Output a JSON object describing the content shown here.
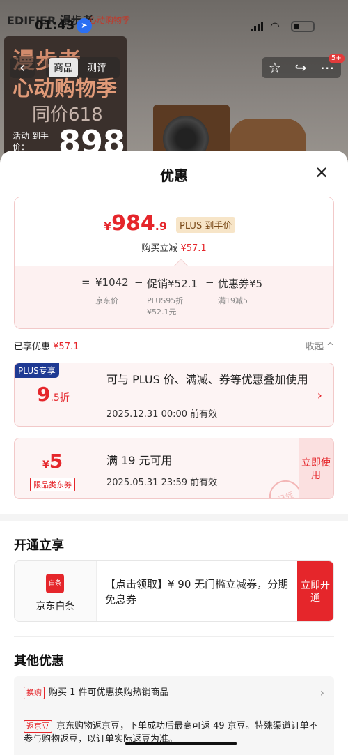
{
  "status": {
    "time": "01:43"
  },
  "background": {
    "brand": "EDIFIER 漫步者",
    "brand_sub": "心动购物季",
    "promo_line1": "漫步者",
    "promo_line2": "心动购物季",
    "promo_line3": "同价618",
    "promo_label": "活动 到手价：",
    "promo_price": "898"
  },
  "nav": {
    "back_icon": "chevron-left-icon",
    "tabs": [
      "商品",
      "测评"
    ],
    "active_tab": 0,
    "badge": "5+"
  },
  "sheet": {
    "title": "优惠",
    "summary": {
      "price_symbol": "¥",
      "price_int": "984",
      "price_dec": ".9",
      "plus_tag": "PLUS 到手价",
      "subtitle": "购买立减",
      "subtitle_amount": "¥57.1",
      "eq": "=",
      "base_price": "¥1042",
      "minus1": "−",
      "promo": "促销¥52.1",
      "minus2": "−",
      "coupon": "优惠券¥5",
      "base_label": "京东价",
      "promo_label1": "PLUS95折",
      "promo_label2": "¥52.1元",
      "coupon_label": "满19减5"
    },
    "enjoyed": {
      "label": "已享优惠",
      "amount": "¥57.1",
      "collapse": "收起 ^"
    },
    "coupons": [
      {
        "header": "PLUS专享",
        "value_big": "9",
        "value_small": ".5折",
        "desc": "可与 PLUS 价、满减、券等优惠叠加使用",
        "date": "2025.12.31 00:00 前有效"
      },
      {
        "symbol": "¥",
        "value_big": "5",
        "tag": "限品类东券",
        "desc": "满 19 元可用",
        "date": "2025.05.31 23:59 前有效",
        "action": "立即使用",
        "stamp": "已领"
      }
    ],
    "open_section": {
      "title": "开通立享",
      "icon_text": "白条",
      "name": "京东白条",
      "text": "【点击领取】¥ 90 无门槛立减券，分期免息券",
      "action": "立即开通"
    },
    "other_section": {
      "title": "其他优惠",
      "items": [
        {
          "tag": "换购",
          "text": "购买 1 件可优惠换购热销商品"
        },
        {
          "tag": "返京豆",
          "text": "京东购物返京豆，下单成功后最高可返 49 京豆。特殊渠道订单不参与购物返豆，以订单实际返豆为准。"
        }
      ]
    }
  },
  "colors": {
    "accent": "#e5262b",
    "plus": "#1f3a93"
  }
}
